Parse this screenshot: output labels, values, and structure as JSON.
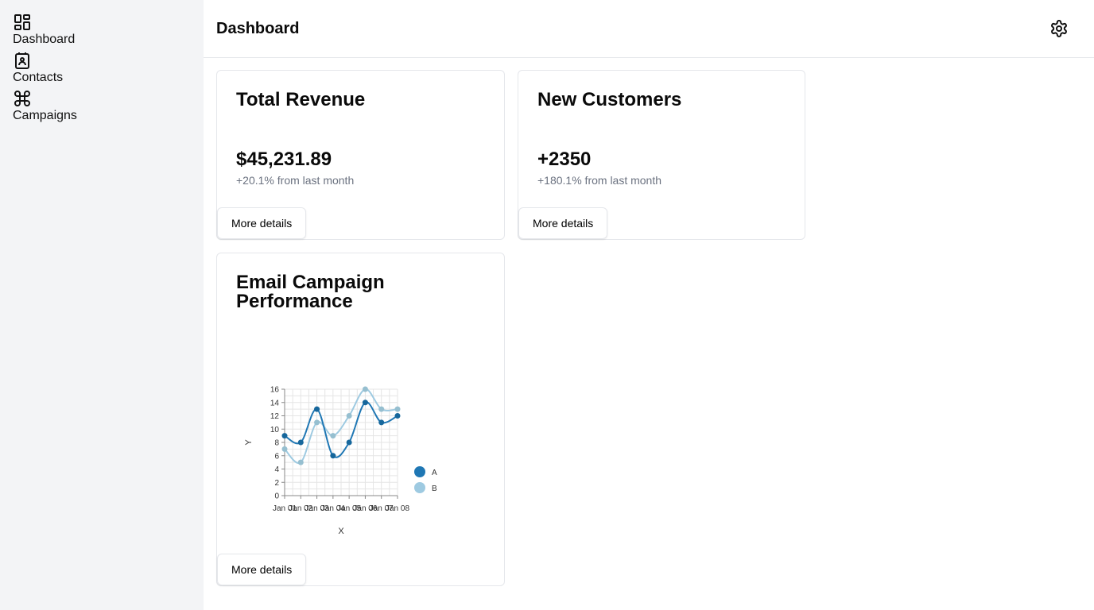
{
  "sidebar": {
    "items": [
      {
        "label": "Dashboard",
        "icon": "dashboard-icon"
      },
      {
        "label": "Contacts",
        "icon": "contact-icon"
      },
      {
        "label": "Campaigns",
        "icon": "command-icon"
      }
    ]
  },
  "header": {
    "title": "Dashboard",
    "settings_icon": "gear-icon"
  },
  "cards": [
    {
      "title": "Total Revenue",
      "value": "$45,231.89",
      "change": "+20.1% from last month",
      "button": "More details"
    },
    {
      "title": "New Customers",
      "value": "+2350",
      "change": "+180.1% from last month",
      "button": "More details"
    },
    {
      "title": "Email Campaign Performance",
      "button": "More details"
    }
  ],
  "chart_data": {
    "type": "line",
    "x": [
      "Jan 01",
      "Jan 02",
      "Jan 03",
      "Jan 04",
      "Jan 05",
      "Jan 06",
      "Jan 07",
      "Jan 08"
    ],
    "series": [
      {
        "name": "A",
        "values": [
          9,
          8,
          13,
          6,
          8,
          14,
          11,
          12
        ],
        "color": "#1f77b4"
      },
      {
        "name": "B",
        "values": [
          7,
          5,
          11,
          9,
          12,
          16,
          13,
          13
        ],
        "color": "#9ecae1"
      }
    ],
    "xlabel": "X",
    "ylabel": "Y",
    "ylim": [
      0,
      16
    ],
    "yticks": [
      0,
      2,
      4,
      6,
      8,
      10,
      12,
      14,
      16
    ],
    "grid": true,
    "legend": "right"
  }
}
